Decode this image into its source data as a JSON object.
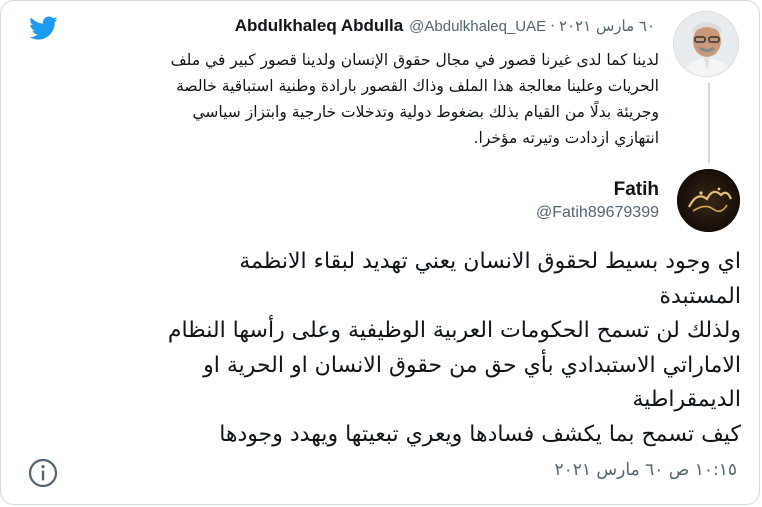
{
  "quoted_tweet": {
    "author_name": "Abdulkhaleq Abdulla",
    "handle": "@Abdulkhaleq_UAE",
    "separator": "·",
    "date": "٦٠ مارس ٢٠٢١",
    "body_lines": [
      "لدينا كما لدى غيرنا قصور في مجال حقوق الإنسان ولدينا قصور كبير في ملف",
      "الحريات وعلينا معالجة هذا الملف وذاك القصور بارادة وطنية استباقية خالصة",
      "وجريئة بدلًا من القيام بذلك بضغوط دولية وتدخلات خارجية وابتزاز سياسي",
      "انتهازي ازدادت وتيرته مؤخرا."
    ]
  },
  "main_tweet": {
    "author_name": "Fatih",
    "handle": "@Fatih89679399",
    "body_lines": [
      "اي وجود بسيط لحقوق الانسان يعني تهديد لبقاء الانظمة",
      "المستبدة",
      "ولذلك لن تسمح الحكومات العربية الوظيفية وعلى رأسها النظام",
      "الاماراتي الاستبدادي بأي حق من حقوق الانسان او الحرية او",
      "الديمقراطية",
      "كيف تسمح بما يكشف فسادها ويعري تبعيتها ويهدد وجودها"
    ],
    "timestamp": "١٠:١٥ ص ٦٠ مارس ٢٠٢١"
  },
  "icons": {
    "brand": "twitter-bird-icon",
    "info": "info-icon",
    "brand_color": "#1d9bf0"
  }
}
